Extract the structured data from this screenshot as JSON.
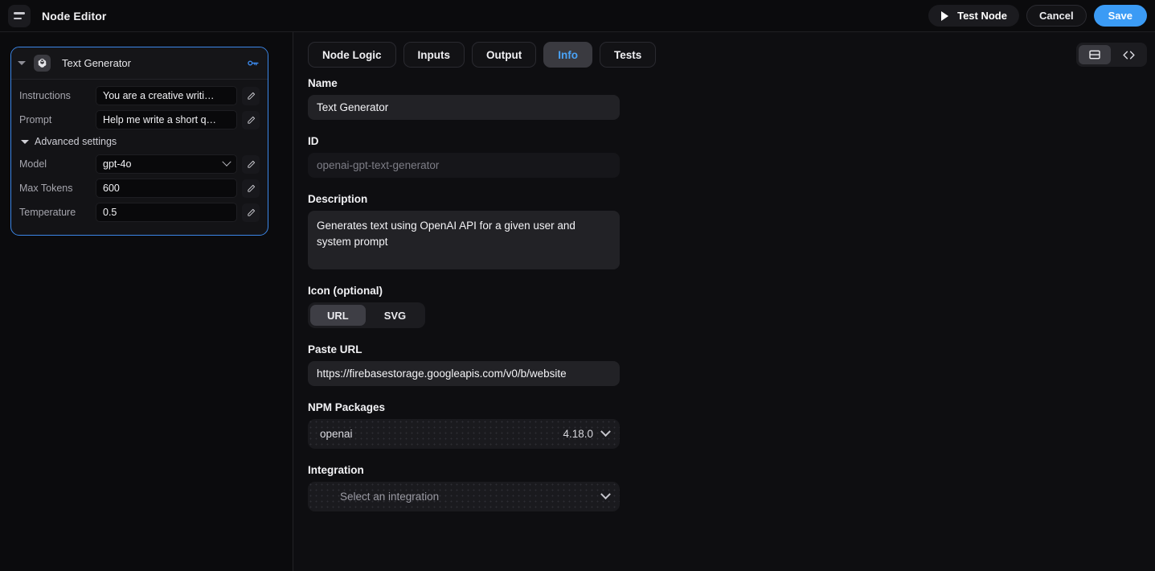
{
  "topbar": {
    "menu_icon": "hamburger-menu-icon",
    "title": "Node Editor",
    "test_button": "Test Node",
    "cancel_button": "Cancel",
    "save_button": "Save"
  },
  "colors": {
    "accent_blue": "#3b9bf5",
    "tab_active_text": "#4aa3f7",
    "node_border": "#3b87e8",
    "panel_bg": "#0e0e11",
    "canvas_bg": "#0b0b0d"
  },
  "canvas": {
    "node": {
      "title": "Text Generator",
      "logo_icon": "openai-logo-icon",
      "collapse_icon": "caret-down-icon",
      "key_icon": "key-icon",
      "fields": [
        {
          "label": "Instructions",
          "value": "You are a creative writi…",
          "type": "text",
          "edit_icon": "pencil-icon"
        },
        {
          "label": "Prompt",
          "value": "Help me write a short q…",
          "type": "text",
          "edit_icon": "pencil-icon"
        }
      ],
      "advanced": {
        "label": "Advanced settings",
        "expanded": true,
        "fields": [
          {
            "label": "Model",
            "value": "gpt-4o",
            "type": "select",
            "edit_icon": "pencil-icon"
          },
          {
            "label": "Max Tokens",
            "value": "600",
            "type": "text",
            "edit_icon": "pencil-icon"
          },
          {
            "label": "Temperature",
            "value": "0.5",
            "type": "text",
            "edit_icon": "pencil-icon"
          }
        ]
      }
    }
  },
  "main": {
    "tabs": [
      {
        "label": "Node Logic",
        "active": false
      },
      {
        "label": "Inputs",
        "active": false
      },
      {
        "label": "Output",
        "active": false
      },
      {
        "label": "Info",
        "active": true
      },
      {
        "label": "Tests",
        "active": false
      }
    ],
    "view_toggle": {
      "split_view_icon": "split-pane-icon",
      "code_view_icon": "code-brackets-icon",
      "active": "split-pane-icon"
    },
    "info": {
      "name": {
        "label": "Name",
        "value": "Text Generator"
      },
      "id": {
        "label": "ID",
        "value": "openai-gpt-text-generator",
        "disabled": true
      },
      "description": {
        "label": "Description",
        "value": "Generates text using OpenAI API for a given user and system prompt"
      },
      "icon_section": {
        "label": "Icon (optional)",
        "options": [
          {
            "label": "URL",
            "active": true
          },
          {
            "label": "SVG",
            "active": false
          }
        ],
        "url_label": "Paste URL",
        "url_value": "https://firebasestorage.googleapis.com/v0/b/website"
      },
      "npm": {
        "label": "NPM Packages",
        "packages": [
          {
            "name": "openai",
            "version": "4.18.0",
            "chevron_icon": "chevron-down-icon"
          }
        ]
      },
      "integration": {
        "label": "Integration",
        "placeholder": "Select an integration",
        "chevron_icon": "chevron-down-icon"
      }
    }
  }
}
